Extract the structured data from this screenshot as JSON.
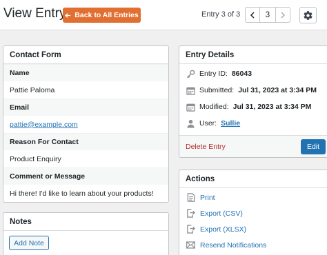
{
  "header": {
    "title": "View Entry",
    "back_label": "Back to All Entries",
    "entry_counter": "Entry 3 of 3",
    "page_number": "3"
  },
  "contact_form": {
    "title": "Contact Form",
    "fields": [
      {
        "label": "Name",
        "value": "Pattie Paloma"
      },
      {
        "label": "Email",
        "value": "pattie@example.com"
      },
      {
        "label": "Reason For Contact",
        "value": "Product Enquiry"
      },
      {
        "label": "Comment or Message",
        "value": "Hi there! I'd like to learn about your products!"
      }
    ]
  },
  "notes": {
    "title": "Notes",
    "add_label": "Add Note"
  },
  "entry_details": {
    "title": "Entry Details",
    "entry_id_label": "Entry ID:",
    "entry_id": "86043",
    "submitted_label": "Submitted:",
    "submitted": "Jul 31, 2023 at 3:34 PM",
    "modified_label": "Modified:",
    "modified": "Jul 31, 2023 at 3:34 PM",
    "user_label": "User:",
    "user": "Sullie",
    "delete_label": "Delete Entry",
    "edit_label": "Edit"
  },
  "actions": {
    "title": "Actions",
    "items": [
      {
        "label": "Print",
        "icon": "print-icon"
      },
      {
        "label": "Export (CSV)",
        "icon": "export-icon"
      },
      {
        "label": "Export (XLSX)",
        "icon": "export-icon"
      },
      {
        "label": "Resend Notifications",
        "icon": "envelope-icon"
      }
    ]
  },
  "colors": {
    "accent_orange": "#e26f32",
    "primary_blue": "#2271b1",
    "danger_red": "#b32d2e"
  }
}
